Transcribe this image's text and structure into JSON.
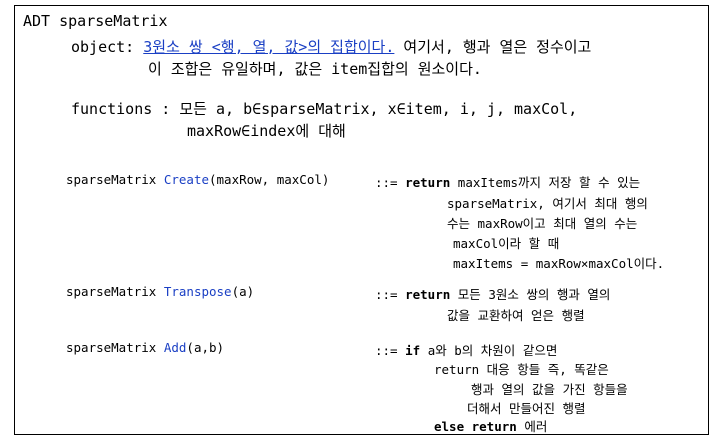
{
  "title": "ADT sparseMatrix",
  "object": {
    "label": "object:",
    "highlight": "3원소 쌍 <행, 열, 값>의 집합이다.",
    "rest": " 여기서, 행과 열은 정수이고",
    "line2": "이 조합은 유일하며, 값은 item집합의 원소이다."
  },
  "functions": {
    "line1": "functions : 모든 a, b∈sparseMatrix, x∈item, i, j, maxCol,",
    "line2": "maxRow∈index에 대해"
  },
  "create": {
    "sig_type": "sparseMatrix ",
    "sig_name": "Create",
    "sig_args": "(maxRow, maxCol)",
    "op": "::= ",
    "keyword": "return",
    "desc1": " maxItems까지 저장 할 수 있는",
    "desc2": "sparseMatrix, 여기서 최대 행의",
    "desc3": "수는 maxRow이고 최대 열의 수는",
    "desc4": "maxCol이라 할 때",
    "desc5": "maxItems = maxRow×maxCol이다."
  },
  "transpose": {
    "sig_type": "sparseMatrix ",
    "sig_name": "Transpose",
    "sig_args": "(a)",
    "op": "::= ",
    "keyword": "return",
    "desc1": " 모든 3원소 쌍의 행과 열의",
    "desc2": "값을 교환하여 얻은 행렬"
  },
  "add": {
    "sig_type": "sparseMatrix ",
    "sig_name": "Add",
    "sig_args": "(a,b)",
    "op": "::= ",
    "keyword": "if",
    "desc1": " a와 b의 차원이 같으면",
    "desc2": "return 대응 항들 즉, 똑같은",
    "desc3": "행과 열의 값을 가진 항들을",
    "desc4": "더해서 만들어진 행렬",
    "else_kw": "else return",
    "else_rest": " 에러"
  }
}
